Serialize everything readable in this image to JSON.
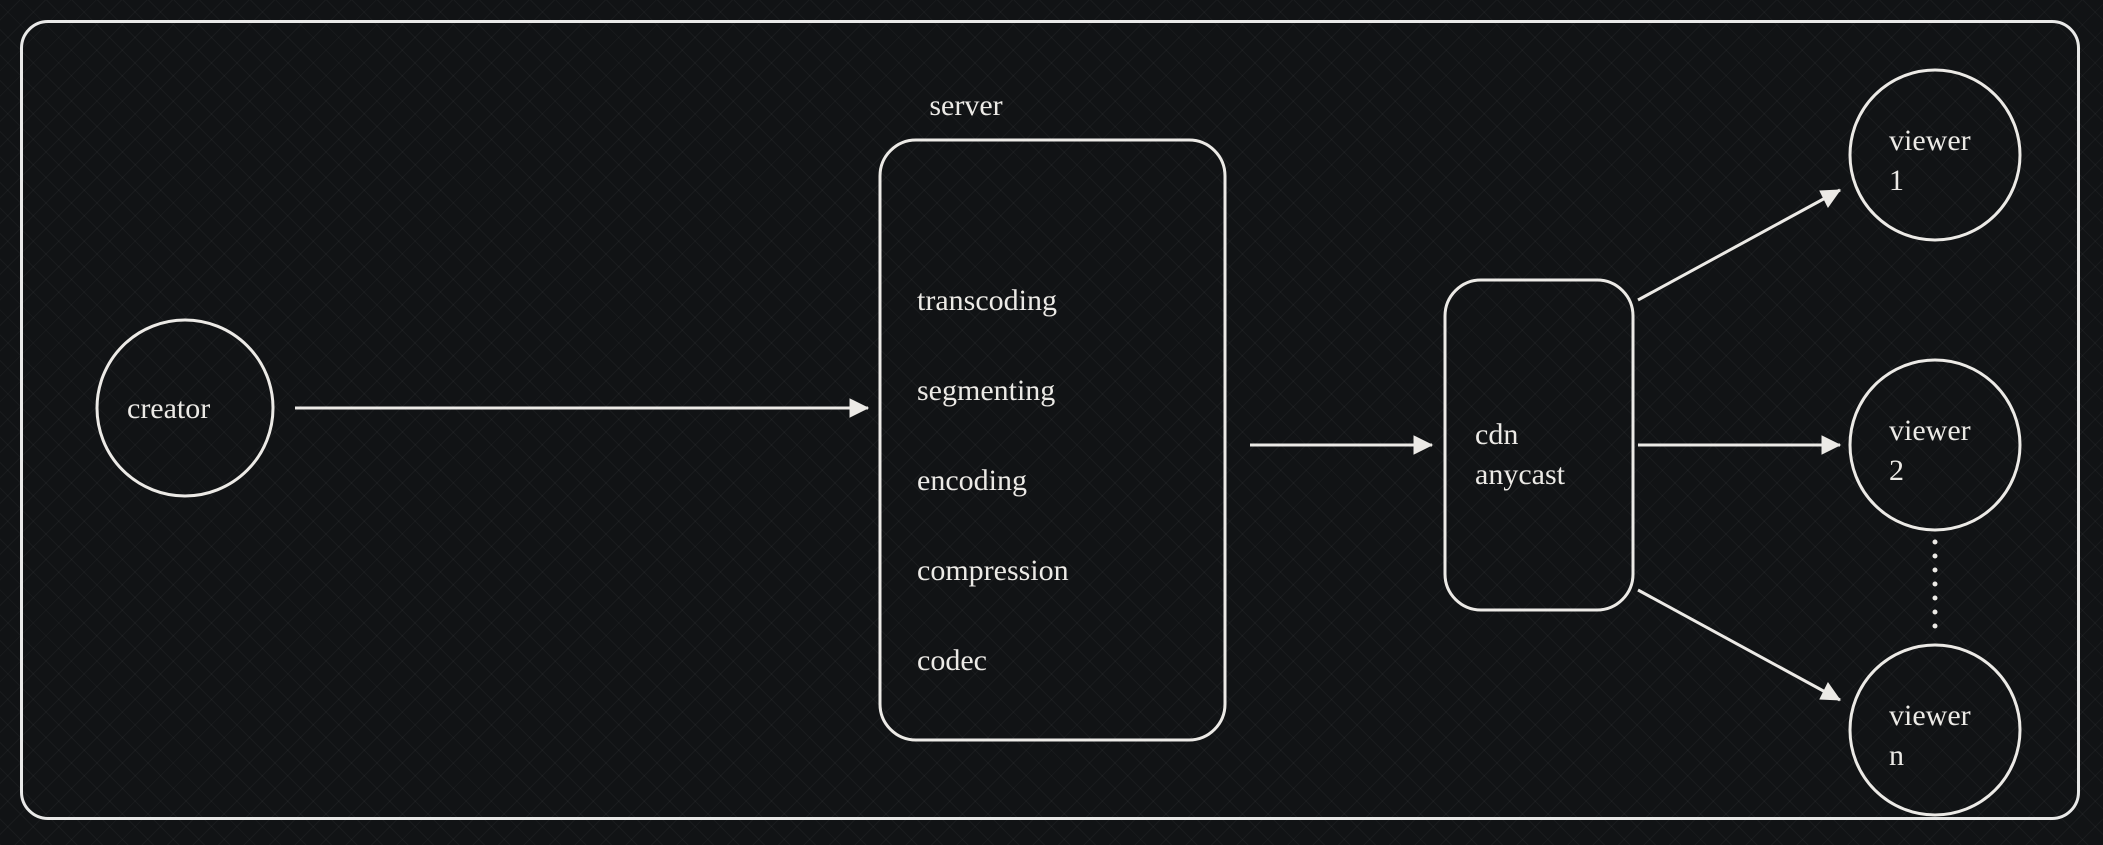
{
  "nodes": {
    "creator": {
      "label": "creator"
    },
    "server": {
      "title": "server",
      "items": [
        "transcoding",
        "segmenting",
        "encoding",
        "compression",
        "codec"
      ]
    },
    "cdn": {
      "line1": "cdn",
      "line2": "anycast"
    },
    "viewer1": {
      "line1": "viewer",
      "line2": "1"
    },
    "viewer2": {
      "line1": "viewer",
      "line2": "2"
    },
    "viewerN": {
      "line1": "viewer",
      "line2": "n"
    }
  },
  "edges": [
    {
      "from": "creator",
      "to": "server"
    },
    {
      "from": "server",
      "to": "cdn"
    },
    {
      "from": "cdn",
      "to": "viewer1"
    },
    {
      "from": "cdn",
      "to": "viewer2"
    },
    {
      "from": "cdn",
      "to": "viewerN"
    }
  ]
}
